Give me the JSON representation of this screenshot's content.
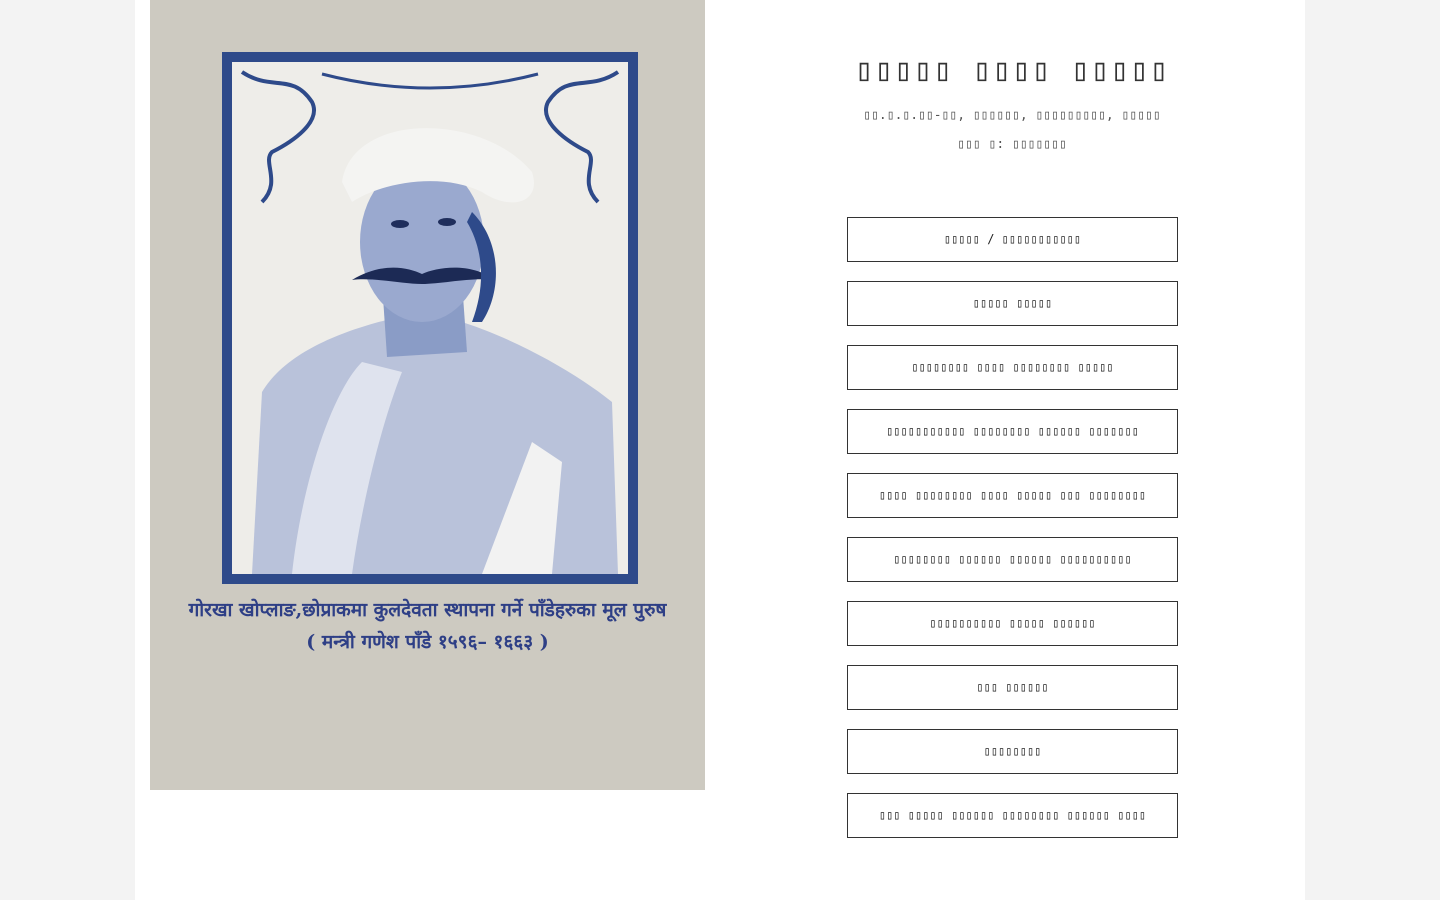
{
  "header": {
    "title": "▯▯▯▯▯ ▯▯▯▯ ▯▯▯▯▯",
    "address": "▯▯.▯.▯.▯▯-▯▯, ▯▯▯▯▯▯, ▯▯▯▯▯▯▯▯▯, ▯▯▯▯▯",
    "phone": "▯▯▯ ▯: ▯▯▯▯▯▯▯"
  },
  "portrait": {
    "caption_line1": "गोरखा खोप्लाङ,छोप्राकमा कुलदेवता स्थापना गर्ने पाँडेहरुका मूल पुरुष",
    "caption_line2": "( मन्त्री गणेश पाँडे १५९६– १६६३ )"
  },
  "menu": {
    "items": [
      "▯▯▯▯▯ / ▯▯▯▯▯▯▯▯▯▯▯",
      "▯▯▯▯▯ ▯▯▯▯▯",
      "▯▯▯▯▯▯▯▯ ▯▯▯▯ ▯▯▯▯▯▯▯▯ ▯▯▯▯▯",
      "▯▯▯▯▯▯▯▯▯▯▯ ▯▯▯▯▯▯▯▯ ▯▯▯▯▯▯ ▯▯▯▯▯▯▯",
      "▯▯▯▯ ▯▯▯▯▯▯▯▯ ▯▯▯▯ ▯▯▯▯▯ ▯▯▯ ▯▯▯▯▯▯▯▯",
      "▯▯▯▯▯▯▯▯ ▯▯▯▯▯▯ ▯▯▯▯▯▯ ▯▯▯▯▯▯▯▯▯▯",
      "▯▯▯▯▯▯▯▯▯▯ ▯▯▯▯▯ ▯▯▯▯▯▯",
      "▯▯▯ ▯▯▯▯▯▯",
      "▯▯▯▯▯▯▯▯",
      "▯▯▯ ▯▯▯▯▯ ▯▯▯▯▯▯ ▯▯▯▯▯▯▯▯ ▯▯▯▯▯▯ ▯▯▯▯"
    ]
  }
}
